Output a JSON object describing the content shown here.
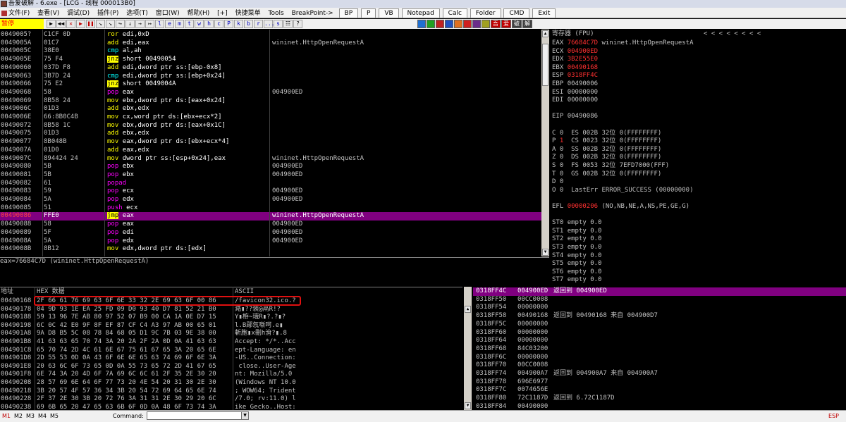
{
  "window": {
    "title": "吾爱破解 - 6.exe - [LCG - 线程 000013B0]"
  },
  "menu": {
    "items": [
      "文件(F)",
      "查看(V)",
      "调试(D)",
      "插件(P)",
      "选项(T)",
      "窗口(W)",
      "帮助(H)",
      "[+]",
      "快捷菜单",
      "Tools",
      "BreakPoint->"
    ],
    "tool_buttons": [
      "BP",
      "P",
      "VB",
      "Notepad",
      "Calc",
      "Folder",
      "CMD",
      "Exit"
    ]
  },
  "toolbar": {
    "status_text": "暂停",
    "buttons": [
      "▶",
      "◀◀",
      "✕",
      "▶",
      "❚❚",
      "↘",
      "↘",
      "↪",
      "↓",
      "→",
      "↦",
      "l",
      "e",
      "m",
      "t",
      "w",
      "h",
      "c",
      "P",
      "k",
      "b",
      "r",
      "...",
      "s",
      "☷",
      "?"
    ],
    "right_hanzi": [
      "吾",
      "爱",
      "破",
      "解"
    ]
  },
  "disasm": {
    "rows": [
      {
        "addr": "0049005?",
        "hex": "C1CF 0D",
        "mn": "ror",
        "ops": "edi,0xD",
        "com": ""
      },
      {
        "addr": "0049005A",
        "hex": "01C7",
        "mn": "add",
        "ops": "edi,eax",
        "com": "wininet.HttpOpenRequestA"
      },
      {
        "addr": "0049005C",
        "hex": "38E0",
        "mn": "cmp",
        "ops": "al,ah",
        "com": ""
      },
      {
        "addr": "0049005E",
        "hex": "75 F4",
        "mn": "jnz",
        "ops": "short 00490054",
        "com": ""
      },
      {
        "addr": "00490060",
        "hex": "037D F8",
        "mn": "add",
        "ops": "edi,dword ptr ss:[ebp-0x8]",
        "com": ""
      },
      {
        "addr": "00490063",
        "hex": "3B7D 24",
        "mn": "cmp",
        "ops": "edi,dword ptr ss:[ebp+0x24]",
        "com": ""
      },
      {
        "addr": "00490066",
        "hex": "75 E2",
        "mn": "jnz",
        "ops": "short 0049004A",
        "com": ""
      },
      {
        "addr": "00490068",
        "hex": "58",
        "mn": "pop",
        "ops": "eax",
        "com": "004900ED"
      },
      {
        "addr": "00490069",
        "hex": "8B58 24",
        "mn": "mov",
        "ops": "ebx,dword ptr ds:[eax+0x24]",
        "com": ""
      },
      {
        "addr": "0049006C",
        "hex": "01D3",
        "mn": "add",
        "ops": "ebx,edx",
        "com": ""
      },
      {
        "addr": "0049006E",
        "hex": "66:8B0C4B",
        "mn": "mov",
        "ops": "cx,word ptr ds:[ebx+ecx*2]",
        "com": ""
      },
      {
        "addr": "00490072",
        "hex": "8B58 1C",
        "mn": "mov",
        "ops": "ebx,dword ptr ds:[eax+0x1C]",
        "com": ""
      },
      {
        "addr": "00490075",
        "hex": "01D3",
        "mn": "add",
        "ops": "ebx,edx",
        "com": ""
      },
      {
        "addr": "00490077",
        "hex": "8B048B",
        "mn": "mov",
        "ops": "eax,dword ptr ds:[ebx+ecx*4]",
        "com": ""
      },
      {
        "addr": "0049007A",
        "hex": "01D0",
        "mn": "add",
        "ops": "eax,edx",
        "com": ""
      },
      {
        "addr": "0049007C",
        "hex": "894424 24",
        "mn": "mov",
        "ops": "dword ptr ss:[esp+0x24],eax",
        "com": "wininet.HttpOpenRequestA"
      },
      {
        "addr": "00490080",
        "hex": "5B",
        "mn": "pop",
        "ops": "ebx",
        "com": "004900ED"
      },
      {
        "addr": "00490081",
        "hex": "5B",
        "mn": "pop",
        "ops": "ebx",
        "com": "004900ED"
      },
      {
        "addr": "00490082",
        "hex": "61",
        "mn": "popad",
        "ops": "",
        "com": ""
      },
      {
        "addr": "00490083",
        "hex": "59",
        "mn": "pop",
        "ops": "ecx",
        "com": "004900ED"
      },
      {
        "addr": "00490084",
        "hex": "5A",
        "mn": "pop",
        "ops": "edx",
        "com": "004900ED"
      },
      {
        "addr": "00490085",
        "hex": "51",
        "mn": "push",
        "ops": "ecx",
        "com": ""
      },
      {
        "addr": "00490086",
        "hex": "FFE0",
        "mn": "jmp",
        "ops": "eax",
        "com": "wininet.HttpOpenRequestA"
      },
      {
        "addr": "00490088",
        "hex": "58",
        "mn": "pop",
        "ops": "eax",
        "com": "004900ED"
      },
      {
        "addr": "00490089",
        "hex": "5F",
        "mn": "pop",
        "ops": "edi",
        "com": "004900ED"
      },
      {
        "addr": "0049008A",
        "hex": "5A",
        "mn": "pop",
        "ops": "edx",
        "com": "004900ED"
      },
      {
        "addr": "0049008B",
        "hex": "8B12",
        "mn": "mov",
        "ops": "edx,dword ptr ds:[edx]",
        "com": ""
      }
    ],
    "selected_row": 22,
    "info_line": "eax=76684C7D (wininet.HttpOpenRequestA)"
  },
  "registers": {
    "header": "寄存器 (FPU)",
    "nav_arrows": "<     <     <     <     <     <     <     <",
    "lines": [
      {
        "k": "EAX ",
        "v": "76684C7D",
        "c": " wininet.HttpOpenRequestA",
        "red": true
      },
      {
        "k": "ECX ",
        "v": "004900ED",
        "c": "",
        "red": true
      },
      {
        "k": "EDX ",
        "v": "3B2E55E0",
        "c": "",
        "red": true
      },
      {
        "k": "EBX ",
        "v": "00490168",
        "c": "",
        "red": true
      },
      {
        "k": "ESP ",
        "v": "0318FF4C",
        "c": "",
        "red": true
      },
      {
        "k": "EBP ",
        "v": "00490006",
        "c": "",
        "red": false
      },
      {
        "k": "ESI ",
        "v": "00000000",
        "c": "",
        "red": false
      },
      {
        "k": "EDI ",
        "v": "00000000",
        "c": "",
        "red": false
      },
      {
        "k": "",
        "v": "",
        "c": "",
        "red": false
      },
      {
        "k": "EIP ",
        "v": "00490086",
        "c": "",
        "red": false
      },
      {
        "k": "",
        "v": "",
        "c": "",
        "red": false
      },
      {
        "k": "C 0  ",
        "v": "",
        "c": "ES 002B 32位 0(FFFFFFFF)",
        "red": false
      },
      {
        "k": "P ",
        "v": "1",
        "c": "  CS 0023 32位 0(FFFFFFFF)",
        "red": true
      },
      {
        "k": "A 0  ",
        "v": "",
        "c": "SS 002B 32位 0(FFFFFFFF)",
        "red": false
      },
      {
        "k": "Z 0  ",
        "v": "",
        "c": "DS 002B 32位 0(FFFFFFFF)",
        "red": false
      },
      {
        "k": "S 0  ",
        "v": "",
        "c": "FS 0053 32位 7EFD7000(FFF)",
        "red": false
      },
      {
        "k": "T 0  ",
        "v": "",
        "c": "GS 002B 32位 0(FFFFFFFF)",
        "red": false
      },
      {
        "k": "D 0",
        "v": "",
        "c": "",
        "red": false
      },
      {
        "k": "O 0  ",
        "v": "",
        "c": "LastErr ERROR_SUCCESS (00000000)",
        "red": false
      },
      {
        "k": "",
        "v": "",
        "c": "",
        "red": false
      },
      {
        "k": "EFL ",
        "v": "00000206",
        "c": " (NO,NB,NE,A,NS,PE,GE,G)",
        "red": true
      },
      {
        "k": "",
        "v": "",
        "c": "",
        "red": false
      },
      {
        "k": "ST0 ",
        "v": "",
        "c": "empty 0.0",
        "red": false
      },
      {
        "k": "ST1 ",
        "v": "",
        "c": "empty 0.0",
        "red": false
      },
      {
        "k": "ST2 ",
        "v": "",
        "c": "empty 0.0",
        "red": false
      },
      {
        "k": "ST3 ",
        "v": "",
        "c": "empty 0.0",
        "red": false
      },
      {
        "k": "ST4 ",
        "v": "",
        "c": "empty 0.0",
        "red": false
      },
      {
        "k": "ST5 ",
        "v": "",
        "c": "empty 0.0",
        "red": false
      },
      {
        "k": "ST6 ",
        "v": "",
        "c": "empty 0.0",
        "red": false
      },
      {
        "k": "ST7 ",
        "v": "",
        "c": "empty 0.0",
        "red": false
      },
      {
        "k": "",
        "v": "",
        "c": "",
        "red": false
      },
      {
        "k": "",
        "v": "",
        "c": "               3 2 1 0      E S P U O Z D I",
        "red": false
      },
      {
        "k": "FST ",
        "v": "",
        "c": "0000  Cond 0 0 0 0  Err 0 0 0 0 0 0 0 0  (GT)",
        "red": false
      }
    ]
  },
  "dump": {
    "header_addr": "地址",
    "header_hex": "HEX 数据",
    "header_ascii": "ASCII",
    "rows": [
      {
        "addr": "00490168",
        "hex": "2F 66 61 76 69 63 6F 6E 33 32 2E 69 63 6F 00 86",
        "ascii": "/favicon32.ico.?"
      },
      {
        "addr": "00490178",
        "hex": "04 9D 93 1E EA 25 FD 09 D0 93 40 D7 81 52 21 B0",
        "ascii": "澔▮??装@鬲R!?"
      },
      {
        "addr": "00490188",
        "hex": "59 13 96 7E AB 80 97 52 07 B9 00 CA 1A 0E D7 15",
        "ascii": "Y▮栫~珴R▮?.?▮?"
      },
      {
        "addr": "00490198",
        "c": "",
        "hex": "6C 0C 42 E0 9F 8F EF 87 CF C4 A3 97 AB 00 65 01",
        "ascii": "l.B鄬忥噺呵.e▮"
      },
      {
        "addr": "004901A8",
        "hex": "9A D8 B5 5C 08 78 84 68 05 D1 9C 7B 03 9E 38 00",
        "ascii": "斬胞▮x刪h洕?▮.8"
      },
      {
        "addr": "004901B8",
        "hex": "41 63 63 65 70 74 3A 20 2A 2F 2A 0D 0A 41 63 63",
        "ascii": "Accept: */*..Acc"
      },
      {
        "addr": "004901C8",
        "hex": "65 70 74 2D 4C 61 6E 67 75 61 67 65 3A 20 65 6E",
        "ascii": "ept-Language: en"
      },
      {
        "addr": "004901D8",
        "hex": "2D 55 53 0D 0A 43 6F 6E 6E 65 63 74 69 6F 6E 3A",
        "ascii": "-US..Connection:"
      },
      {
        "addr": "004901E8",
        "hex": "20 63 6C 6F 73 65 0D 0A 55 73 65 72 2D 41 67 65",
        "ascii": " close..User-Age"
      },
      {
        "addr": "004901F8",
        "hex": "6E 74 3A 20 4D 6F 7A 69 6C 6C 61 2F 35 2E 30 20",
        "ascii": "nt: Mozilla/5.0 "
      },
      {
        "addr": "00490208",
        "hex": "28 57 69 6E 64 6F 77 73 20 4E 54 20 31 30 2E 30",
        "ascii": "(Windows NT 10.0"
      },
      {
        "addr": "00490218",
        "hex": "3B 20 57 4F 57 36 34 3B 20 54 72 69 64 65 6E 74",
        "ascii": "; WOW64; Trident"
      },
      {
        "addr": "00490228",
        "hex": "2F 37 2E 30 3B 20 72 76 3A 31 31 2E 30 29 20 6C",
        "ascii": "/7.0; rv:11.0) l"
      },
      {
        "addr": "00490238",
        "hex": "69 6B 65 20 47 65 63 6B 6F 0D 0A 48 6F 73 74 3A",
        "ascii": "ike Gecko..Host:"
      }
    ]
  },
  "stack": {
    "rows": [
      {
        "addr": "0318FF4C",
        "val": "004900ED",
        "com": "返回到 004900ED"
      },
      {
        "addr": "0318FF50",
        "val": "00CC0008",
        "com": ""
      },
      {
        "addr": "0318FF54",
        "val": "00000000",
        "com": ""
      },
      {
        "addr": "0318FF58",
        "val": "00490168",
        "com": "返回到 00490168 来自 004900D7"
      },
      {
        "addr": "0318FF5C",
        "val": "00000000",
        "com": ""
      },
      {
        "addr": "0318FF60",
        "val": "00000000",
        "com": ""
      },
      {
        "addr": "0318FF64",
        "val": "00000000",
        "com": ""
      },
      {
        "addr": "0318FF68",
        "val": "84C03200",
        "com": ""
      },
      {
        "addr": "0318FF6C",
        "val": "00000000",
        "com": ""
      },
      {
        "addr": "0318FF70",
        "val": "00CC0008",
        "com": ""
      },
      {
        "addr": "0318FF74",
        "val": "004900A7",
        "com": "返回到 004900A7 来自 004900A7"
      },
      {
        "addr": "0318FF78",
        "val": "696E6977",
        "com": ""
      },
      {
        "addr": "0318FF7C",
        "val": "0074656E",
        "com": ""
      },
      {
        "addr": "0318FF80",
        "val": "72C1187D",
        "com": "返回到 6.72C1187D"
      },
      {
        "addr": "0318FF84",
        "val": "00490000",
        "com": ""
      }
    ]
  },
  "cmdbar": {
    "markers": [
      "M1",
      "M2",
      "M3",
      "M4",
      "M5"
    ],
    "label": "Command:",
    "value": "",
    "right": "ESP"
  }
}
